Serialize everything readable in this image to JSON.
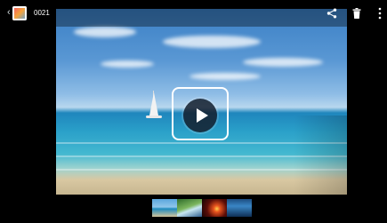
{
  "header": {
    "title": "0021",
    "back_icon": "chevron-left-icon",
    "app_icon": "gallery-app-icon",
    "actions": [
      "share-icon",
      "trash-icon",
      "overflow-menu-icon"
    ]
  },
  "media": {
    "type": "video",
    "preview_description": "beach",
    "play_icon": "play-icon"
  },
  "filmstrip": {
    "thumbnails": [
      "thumbnail-beach",
      "thumbnail-landscape",
      "thumbnail-sunset",
      "thumbnail-blue"
    ]
  },
  "colors": {
    "topbar_overlay": "#000000",
    "play_button_bg": "#141e2d",
    "text": "#ffffff"
  }
}
